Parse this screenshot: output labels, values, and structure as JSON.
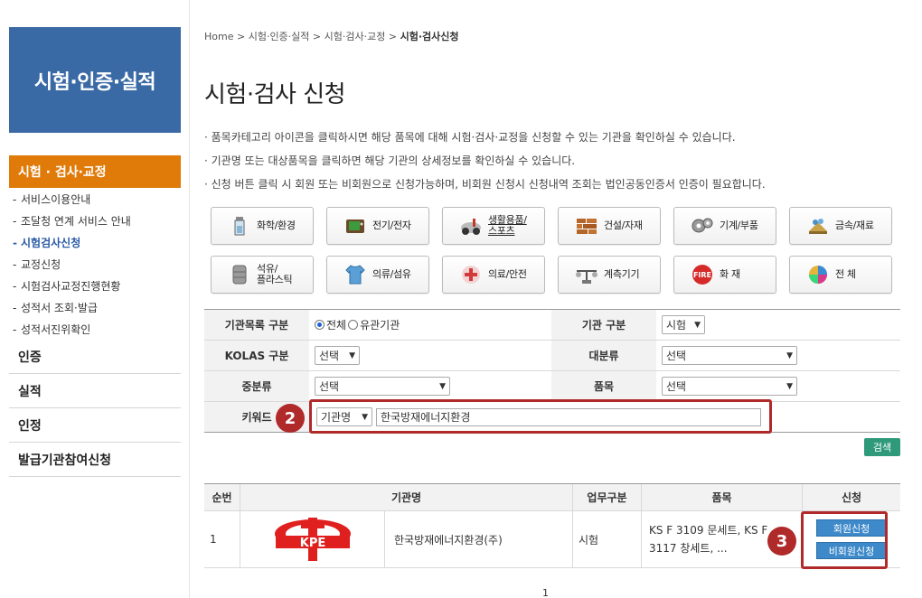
{
  "sidebar": {
    "banner": "시험·인증·실적",
    "active": "시험 · 검사·교정",
    "sub_items": [
      {
        "label": "서비스이용안내"
      },
      {
        "label": "조달청 연계 서비스 안내"
      },
      {
        "label": "시험검사신청"
      },
      {
        "label": "교정신청"
      },
      {
        "label": "시험검사교정진행현황"
      },
      {
        "label": "성적서 조회·발급"
      },
      {
        "label": "성적서진위확인"
      }
    ],
    "menu": [
      {
        "label": "인증"
      },
      {
        "label": "실적"
      },
      {
        "label": "인정"
      },
      {
        "label": "발급기관참여신청"
      }
    ]
  },
  "breadcrumb": {
    "items": [
      "Home",
      "시험·인증·실적",
      "시험·검사·교정"
    ],
    "sep": ">",
    "current": "시험·검사신청"
  },
  "page": {
    "title": "시험·검사 신청",
    "desc": [
      "· 품목카테고리 아이콘을 클릭하시면 해당 품목에 대해 시험·검사·교정을 신청할 수 있는 기관을 확인하실 수 있습니다.",
      "· 기관명 또는 대상품목을 클릭하면 해당 기관의 상세정보를 확인하실 수 있습니다.",
      "· 신청 버튼 클릭 시 회원 또는 비회원으로 신청가능하며, 비회원 신청시 신청내역 조회는 법인공동인증서 인증이 필요합니다."
    ]
  },
  "categories": [
    {
      "label": "화학/환경",
      "icon": "chemistry-icon"
    },
    {
      "label": "전기/전자",
      "icon": "electronics-icon"
    },
    {
      "label": "생활용품/\n스포츠",
      "icon": "sports-icon"
    },
    {
      "label": "건설/자재",
      "icon": "brick-icon"
    },
    {
      "label": "기계/부품",
      "icon": "gear-icon"
    },
    {
      "label": "금속/재료",
      "icon": "metal-icon"
    },
    {
      "label": "석유/\n플라스틱",
      "icon": "oil-barrel-icon"
    },
    {
      "label": "의류/섬유",
      "icon": "clothing-icon"
    },
    {
      "label": "의료/안전",
      "icon": "medical-icon"
    },
    {
      "label": "계측기기",
      "icon": "measurement-icon"
    },
    {
      "label": "화 재",
      "icon": "fire-icon"
    },
    {
      "label": "전 체",
      "icon": "all-icon"
    }
  ],
  "search": {
    "org_list_label": "기관목록 구분",
    "radio_all": "전체",
    "radio_related": "유관기관",
    "org_type_label": "기관 구분",
    "org_type_value": "시험",
    "kolas_label": "KOLAS 구분",
    "kolas_value": "선택",
    "major_label": "대분류",
    "major_value": "선택",
    "middle_label": "중분류",
    "middle_value": "선택",
    "item_label": "품목",
    "item_value": "선택",
    "keyword_label": "키워드",
    "keyword_type": "기관명",
    "keyword_value": "한국방재에너지환경",
    "search_button": "검색"
  },
  "results": {
    "headers": [
      "순번",
      "기관명",
      "업무구분",
      "품목",
      "신청"
    ],
    "rows": [
      {
        "no": "1",
        "logo_text": "KPE",
        "org_name": "한국방재에너지환경(주)",
        "work": "시험",
        "items_line1": "KS F 3109 문세트, KS F",
        "items_line2": "3117 창세트, ...",
        "member_btn": "회원신청",
        "nonmember_btn": "비회원신청"
      }
    ]
  },
  "annotations": {
    "marker2": "2",
    "marker3": "3"
  },
  "pager": {
    "current": "1"
  },
  "colors": {
    "banner": "#3a6aa5",
    "active": "#e07b0a",
    "annotation": "#b02a2a",
    "button": "#3d89c9",
    "search": "#2f9a7a"
  }
}
